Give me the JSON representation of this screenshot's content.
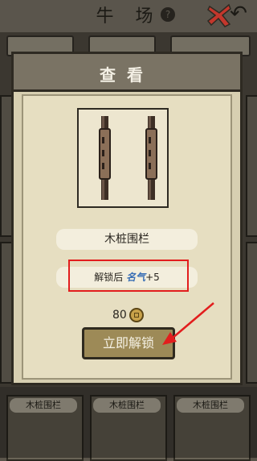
{
  "background": {
    "title": "牛 场",
    "help_icon": "question-mark-icon",
    "back_icon": "back-arrow-icon",
    "bottom_labels": [
      "木桩围栏",
      "木桩围栏",
      "木桩围栏"
    ]
  },
  "dialog": {
    "title": "查看",
    "close_icon": "close-x-icon",
    "item_preview_icon": "wooden-fence-posts-image",
    "item_name": "木桩围栏",
    "unlock_prefix": "解锁后",
    "unlock_reward_name": "名气",
    "unlock_reward_value": "+5",
    "price": "80",
    "currency_icon": "coin-icon",
    "unlock_button_label": "立即解锁"
  },
  "colors": {
    "highlight_red": "#e21d1d",
    "button_gold": "#9d8a57",
    "dialog_bg": "#d7cfb1"
  }
}
